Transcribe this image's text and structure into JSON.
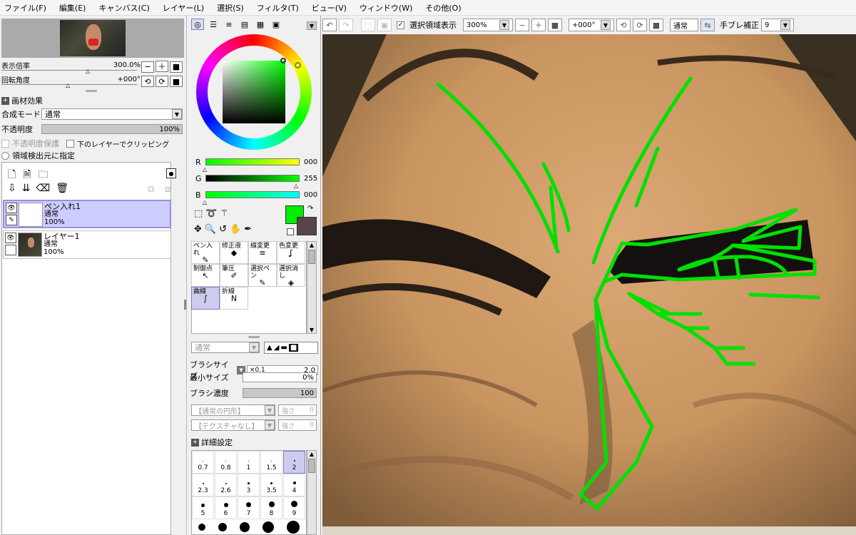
{
  "menu": [
    "ファイル(F)",
    "編集(E)",
    "キャンバス(C)",
    "レイヤー(L)",
    "選択(S)",
    "フィルタ(T)",
    "ビュー(V)",
    "ウィンドウ(W)",
    "その他(O)"
  ],
  "toolbar": {
    "selection_label": "選択領域表示",
    "zoom": "300%",
    "rotation": "+000°",
    "mode": "通常",
    "stabilizer_label": "手ブレ補正",
    "stabilizer_value": "9"
  },
  "nav": {
    "zoom_label": "表示倍率",
    "zoom_value": "300.0%",
    "angle_label": "回転角度",
    "angle_value": "+000°"
  },
  "paper": {
    "effect_label": "画材効果",
    "blend_label": "合成モード",
    "blend_value": "通常",
    "opacity_label": "不透明度",
    "opacity_value": "100%",
    "protect_label": "不透明度保護",
    "clip_label": "下のレイヤーでクリッピング",
    "source_label": "領域検出元に指定"
  },
  "layers": [
    {
      "name": "ペン入れ1",
      "mode": "通常",
      "opacity": "100%"
    },
    {
      "name": "レイヤー1",
      "mode": "通常",
      "opacity": "100%"
    }
  ],
  "color": {
    "r_label": "R",
    "r": "000",
    "g_label": "G",
    "g": "255",
    "b_label": "B",
    "b": "000",
    "primary": "#00ee00",
    "secondary": "#5a434a"
  },
  "tools": [
    [
      "ペン入れ",
      "修正液",
      "線変更",
      "色変更"
    ],
    [
      "制御点",
      "筆圧",
      "選択ペン",
      "選択消し"
    ],
    [
      "曲線",
      "折線",
      "",
      ""
    ]
  ],
  "brush": {
    "mode": "通常",
    "size_label": "ブラシサイズ",
    "size_mult": "×0.1",
    "size_value": "2.0",
    "min_label": "最小サイズ",
    "min_value": "0%",
    "density_label": "ブラシ濃度",
    "density_value": "100",
    "shape": "【通常の円形】",
    "texture": "【テクスチャなし】",
    "strength_label": "強さ",
    "strength1": "0",
    "strength2": "0",
    "detail_label": "詳細設定"
  },
  "sizes": [
    [
      "0.7",
      "0.8",
      "1",
      "1.5",
      "2"
    ],
    [
      "2.3",
      "2.6",
      "3",
      "3.5",
      "4"
    ],
    [
      "5",
      "6",
      "7",
      "8",
      "9"
    ]
  ]
}
